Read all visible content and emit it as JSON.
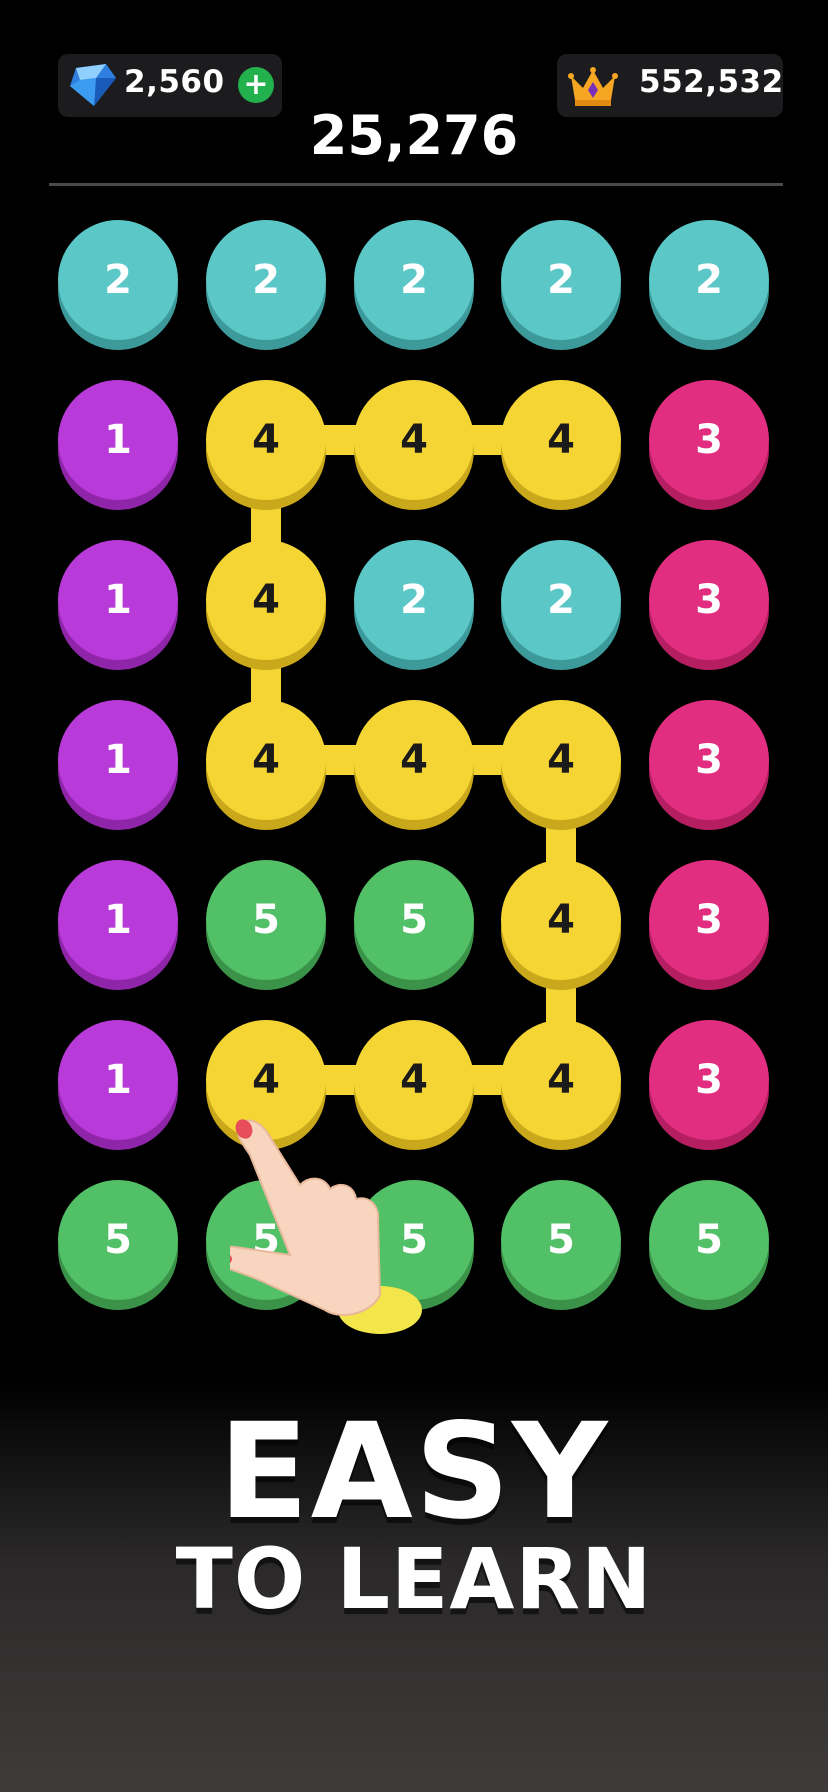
{
  "header": {
    "gems": "2,560",
    "plus_symbol": "+",
    "best_score": "552,532",
    "current_score": "25,276"
  },
  "colors": {
    "1": "#b83ad8",
    "2": "#5cc7c7",
    "3": "#e22e80",
    "4": "#f5d534",
    "5": "#52c066"
  },
  "shade_colors": {
    "1": "#8f25a8",
    "2": "#3c9a9a",
    "3": "#b51f62",
    "4": "#c9a81c",
    "5": "#3a9349"
  },
  "grid": [
    [
      "2",
      "2",
      "2",
      "2",
      "2"
    ],
    [
      "1",
      "4",
      "4",
      "4",
      "3"
    ],
    [
      "1",
      "4",
      "2",
      "2",
      "3"
    ],
    [
      "1",
      "4",
      "4",
      "4",
      "3"
    ],
    [
      "1",
      "5",
      "5",
      "4",
      "3"
    ],
    [
      "1",
      "4",
      "4",
      "4",
      "3"
    ],
    [
      "5",
      "5",
      "5",
      "5",
      "5"
    ]
  ],
  "path": [
    [
      5,
      1
    ],
    [
      5,
      2
    ],
    [
      5,
      3
    ],
    [
      4,
      3
    ],
    [
      3,
      3
    ],
    [
      3,
      2
    ],
    [
      3,
      1
    ],
    [
      2,
      1
    ],
    [
      1,
      1
    ],
    [
      1,
      2
    ],
    [
      1,
      3
    ]
  ],
  "icons": {
    "gem": "gem-icon",
    "plus": "plus-icon",
    "crown": "crown-icon",
    "hand": "pointing-hand-icon"
  },
  "headline": {
    "line1": "EASY",
    "line2": "TO LEARN"
  }
}
